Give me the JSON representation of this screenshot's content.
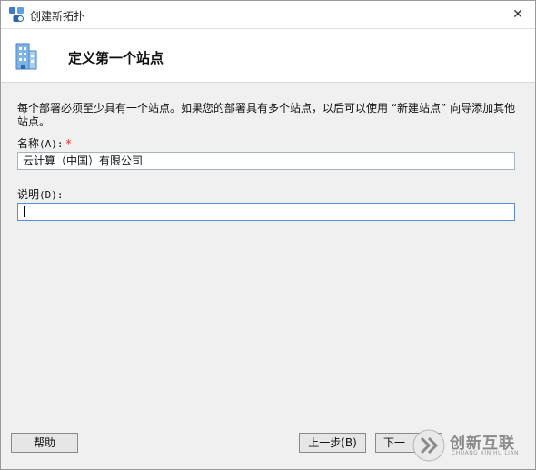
{
  "window": {
    "title": "创建新拓扑",
    "close_symbol": "✕"
  },
  "header": {
    "title": "定义第一个站点",
    "icon": "building-icon"
  },
  "content": {
    "description": "每个部署必须至少具有一个站点。如果您的部署具有多个站点，以后可以使用 “新建站点” 向导添加其他站点。",
    "name_field": {
      "label": "名称",
      "mnemonic": "(A):",
      "required_mark": "*",
      "value": "云计算（中国）有限公司"
    },
    "description_field": {
      "label": "说明",
      "mnemonic": "(D):",
      "value": ""
    }
  },
  "footer": {
    "help_label": "帮助",
    "back_label": "上一步(B)",
    "next_label": "下一"
  },
  "watermark": {
    "text": "创新互联",
    "subtext": "CHUANG XIN HU LIAN"
  },
  "colors": {
    "required": "#e0302a",
    "input_border": "#a9b3bf",
    "dialog_bg": "#f0f0f0"
  }
}
